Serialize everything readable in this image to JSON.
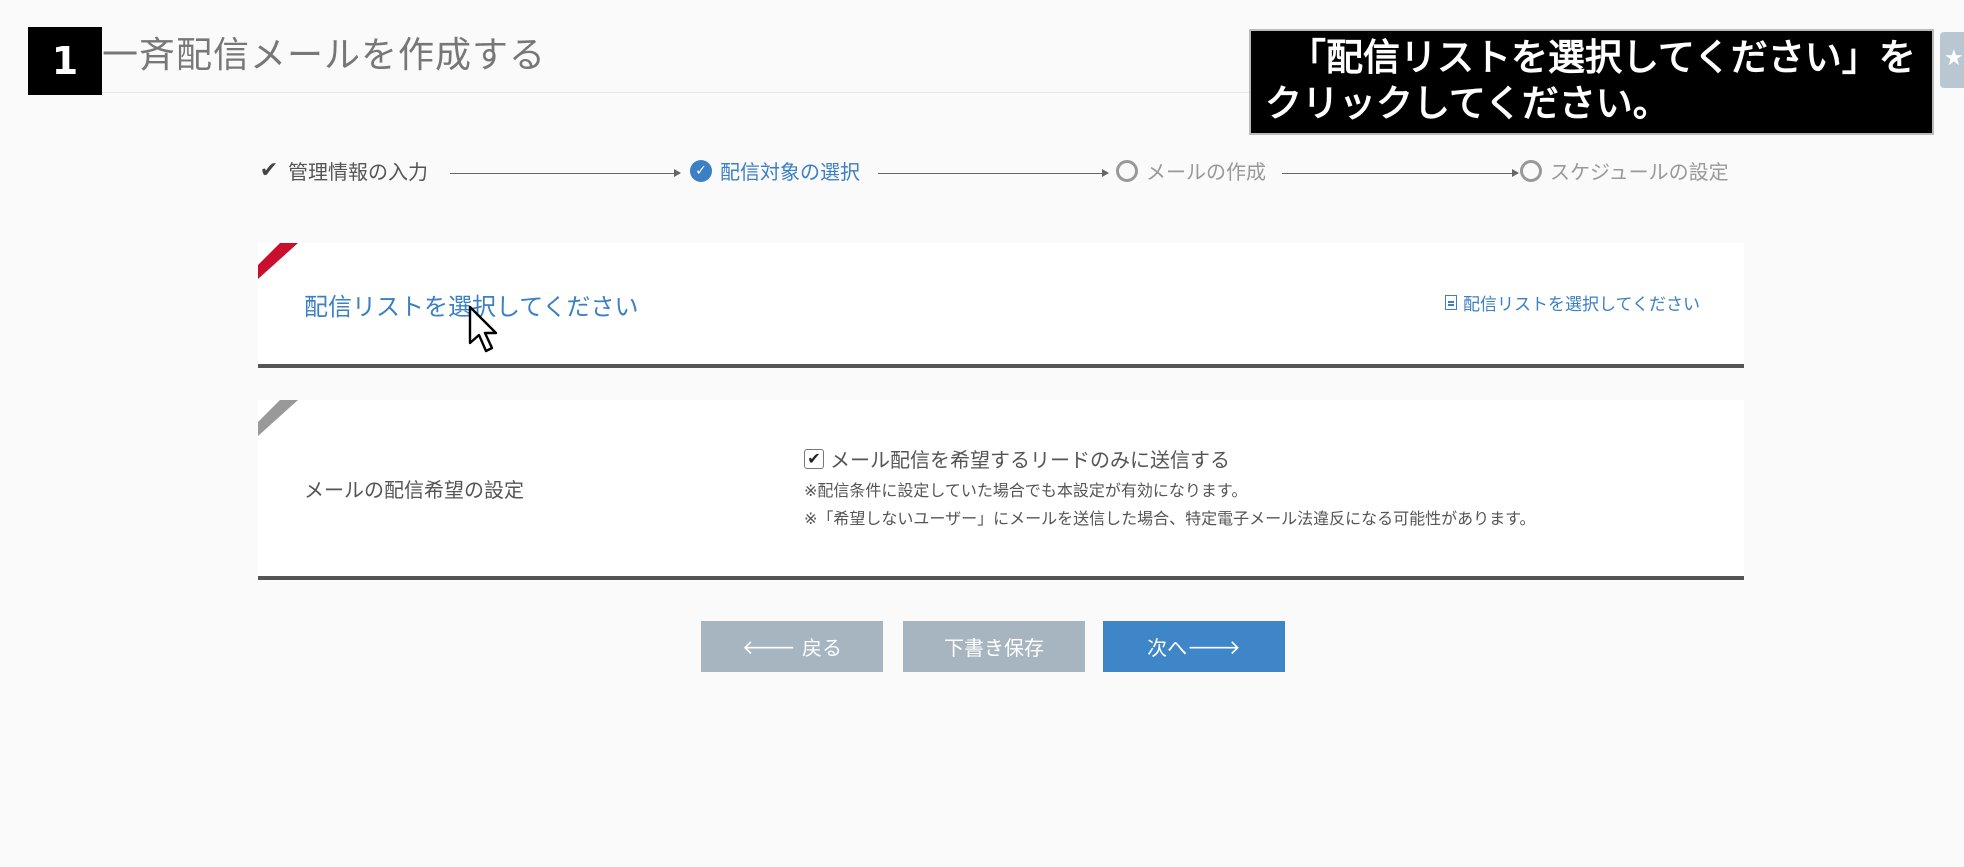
{
  "overlay": {
    "step_number": "1",
    "callout_line1": "「配信リストを選択してください」を",
    "callout_line2": "クリックしてください。"
  },
  "page": {
    "title": "一斉配信メールを作成する"
  },
  "wizard": {
    "steps": [
      {
        "label": "管理情報の入力",
        "state": "done"
      },
      {
        "label": "配信対象の選択",
        "state": "active"
      },
      {
        "label": "メールの作成",
        "state": "pending"
      },
      {
        "label": "スケジュールの設定",
        "state": "pending"
      }
    ]
  },
  "list_panel": {
    "link_text": "配信リストを選択してください",
    "side_link_text": "配信リストを選択してください",
    "corner_color": "#c8102e"
  },
  "optin_panel": {
    "label": "メールの配信希望の設定",
    "checkbox_label": "メール配信を希望するリードのみに送信する",
    "checkbox_checked": true,
    "note1": "※配信条件に設定していた場合でも本設定が有効になります。",
    "note2": "※「希望しないユーザー」にメールを送信した場合、特定電子メール法違反になる可能性があります。",
    "corner_color": "#999999"
  },
  "buttons": {
    "back": "戻る",
    "draft": "下書き保存",
    "next": "次へ"
  },
  "colors": {
    "accent": "#3b7fc4",
    "button_primary": "#3e86c8",
    "button_secondary": "#a7b5c0"
  },
  "icons": {
    "done": "check-icon",
    "active": "check-circle-icon",
    "pending": "circle-outline-icon",
    "side_link": "document-icon",
    "back_arrow": "arrow-left-icon",
    "next_arrow": "arrow-right-icon"
  }
}
